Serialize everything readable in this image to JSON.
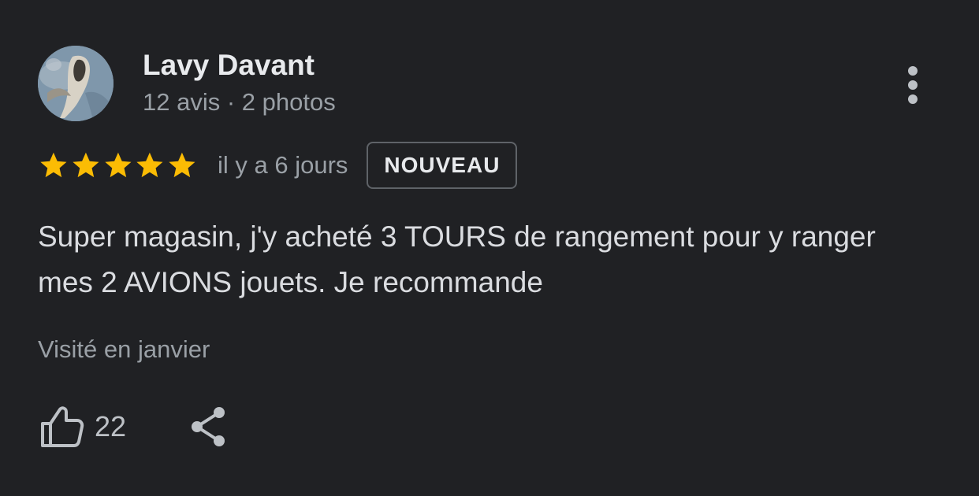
{
  "author": {
    "name": "Lavy Davant",
    "meta": "12 avis · 2 photos"
  },
  "review": {
    "rating": 5,
    "rating_max": 5,
    "date": "il y a 6 jours",
    "badge": "NOUVEAU",
    "text": "Super magasin, j'y acheté 3 TOURS de rangement pour y ranger mes 2 AVIONS jouets. Je recommande",
    "visited": "Visité en janvier"
  },
  "actions": {
    "like_count": "22",
    "like_icon": "thumbs-up-icon",
    "share_icon": "share-icon",
    "more_icon": "more-vert-icon"
  },
  "colors": {
    "background": "#202124",
    "star": "#fbbc04",
    "primary_text": "#e8eaed",
    "secondary_text": "#9aa0a6"
  }
}
